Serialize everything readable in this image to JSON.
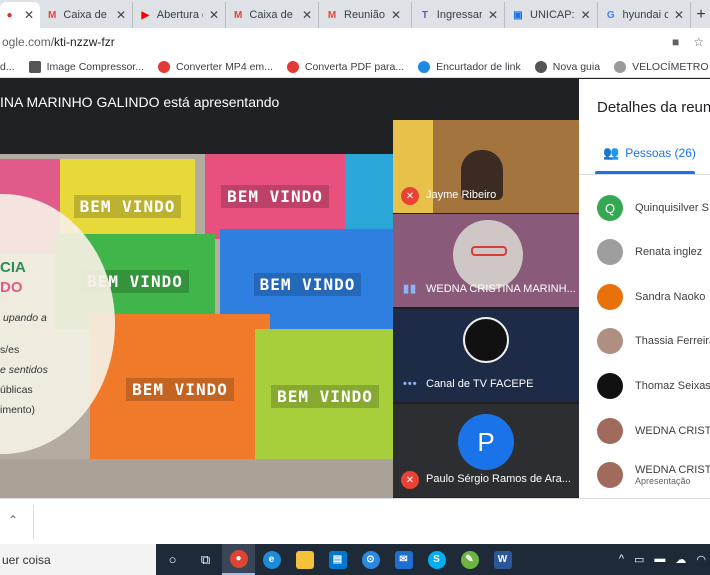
{
  "browser": {
    "tabs": [
      {
        "label": "",
        "icon": "record-icon",
        "color": "#d93025",
        "active": true
      },
      {
        "label": "Caixa de e",
        "icon": "gmail-icon",
        "color": "#ea4335"
      },
      {
        "label": "Abertura c",
        "icon": "youtube-icon",
        "color": "#ff0000"
      },
      {
        "label": "Caixa de e",
        "icon": "gmail-icon",
        "color": "#ea4335"
      },
      {
        "label": "Reunião",
        "icon": "gmail-icon",
        "color": "#ea4335"
      },
      {
        "label": "Ingressar",
        "icon": "teams-icon",
        "color": "#5b5fc7"
      },
      {
        "label": "UNICAP:",
        "icon": "unicap-icon",
        "color": "#1a73e8"
      },
      {
        "label": "hyundai c",
        "icon": "google-icon",
        "color": "#4285f4"
      }
    ],
    "url_prefix": "ogle.com/",
    "url_path": "kti-nzzw-fzr",
    "bookmarks": [
      {
        "label": "d...",
        "color": "#888"
      },
      {
        "label": "Image Compressor...",
        "color": "#555"
      },
      {
        "label": "Converter MP4 em...",
        "color": "#e53935"
      },
      {
        "label": "Converta PDF para...",
        "color": "#e53935"
      },
      {
        "label": "Encurtador de link",
        "color": "#1e88e5"
      },
      {
        "label": "Nova guia",
        "color": "#555"
      },
      {
        "label": "VELOCÍMETRO - Te...",
        "color": "#777"
      }
    ]
  },
  "meet": {
    "presenting_text": "INA MARINHO GALINDO está apresentando",
    "slide": {
      "rug_text": "BEM VINDO",
      "overlay_big_1": "CIA",
      "overlay_big_2": "DO",
      "overlay_lines": [
        "upando a",
        "s/es",
        "e sentidos",
        "úblicas",
        "imento)"
      ]
    },
    "tiles": [
      {
        "name": "Jayme Ribeiro",
        "muted": true
      },
      {
        "name": "WEDNA CRISTINA MARINH...",
        "speaking": true
      },
      {
        "name": "Canal de TV FACEPE",
        "speaking": true
      },
      {
        "name": "Paulo Sérgio Ramos de Ara...",
        "muted": true,
        "initial": "P"
      }
    ]
  },
  "panel": {
    "title": "Detalhes da reunião",
    "people_tab": "Pessoas (26)",
    "people": [
      {
        "name": "Quinquisilver S",
        "initial": "Q",
        "color": "#34a853"
      },
      {
        "name": "Renata inglez",
        "initial": "",
        "color": "#9e9e9e"
      },
      {
        "name": "Sandra Naoko",
        "initial": "",
        "color": "#e8710a"
      },
      {
        "name": "Thassia Ferreira",
        "initial": "",
        "color": "#b08f83"
      },
      {
        "name": "Thomaz Seixas",
        "initial": "",
        "color": "#111111"
      },
      {
        "name": "WEDNA CRISTI",
        "initial": "",
        "color": "#a06a5c"
      },
      {
        "name": "WEDNA CRISTI",
        "initial": "",
        "color": "#a06a5c",
        "sub": "Apresentação"
      }
    ]
  },
  "taskbar": {
    "search_text": "uer coisa"
  }
}
